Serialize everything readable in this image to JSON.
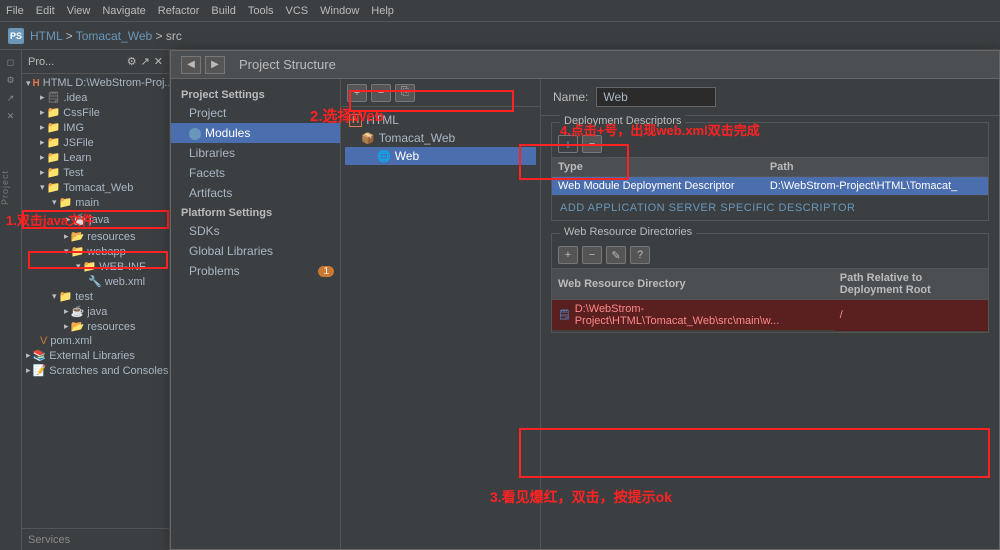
{
  "menubar": {
    "items": [
      "File",
      "Edit",
      "View",
      "Navigate",
      "Refactor",
      "Build",
      "Tools",
      "VCS",
      "Window",
      "Help"
    ]
  },
  "titlebar": {
    "title": "Project Structure",
    "icon_text": "PS"
  },
  "breadcrumb": {
    "parts": [
      "HTML",
      "Tomacat_Web",
      "src"
    ]
  },
  "left_panel": {
    "header": "Project",
    "tree": [
      {
        "label": "Pro...",
        "indent": 0,
        "icon": "📁"
      },
      {
        "label": "HTML D:\\WebStrom-Proj...",
        "indent": 0,
        "icon": "🗂",
        "selected": false
      },
      {
        "label": "idea",
        "indent": 1,
        "icon": "📁"
      },
      {
        "label": "CssFile",
        "indent": 1,
        "icon": "📁"
      },
      {
        "label": "IMG",
        "indent": 1,
        "icon": "📁"
      },
      {
        "label": "JSFile",
        "indent": 1,
        "icon": "📁"
      },
      {
        "label": "Learn",
        "indent": 1,
        "icon": "📁"
      },
      {
        "label": "Test",
        "indent": 1,
        "icon": "📁"
      },
      {
        "label": "Tomacat_Web",
        "indent": 1,
        "icon": "📁"
      },
      {
        "label": "main",
        "indent": 2,
        "icon": "📁"
      },
      {
        "label": "java",
        "indent": 3,
        "icon": "📁",
        "selected": true
      },
      {
        "label": "resources",
        "indent": 3,
        "icon": "📁"
      },
      {
        "label": "webapp",
        "indent": 3,
        "icon": "📁"
      },
      {
        "label": "WEB-INF",
        "indent": 4,
        "icon": "📁"
      },
      {
        "label": "web.xml",
        "indent": 5,
        "icon": "🔧"
      },
      {
        "label": "test",
        "indent": 2,
        "icon": "📁"
      },
      {
        "label": "java",
        "indent": 3,
        "icon": "📁"
      },
      {
        "label": "resources",
        "indent": 3,
        "icon": "📁"
      },
      {
        "label": "pom.xml",
        "indent": 1,
        "icon": "🔧"
      },
      {
        "label": "External Libraries",
        "indent": 0,
        "icon": "📚"
      },
      {
        "label": "Scratches and Consoles",
        "indent": 0,
        "icon": "📝"
      }
    ]
  },
  "dialog": {
    "title": "Project Structure",
    "nav": {
      "back_label": "◀",
      "forward_label": "▶"
    },
    "settings_tree": {
      "project_settings_title": "Project Settings",
      "project_settings_items": [
        "Project",
        "Modules",
        "Libraries",
        "Facets",
        "Artifacts"
      ],
      "platform_settings_title": "Platform Settings",
      "platform_settings_items": [
        "SDKs",
        "Global Libraries",
        "Problems"
      ],
      "selected_item": "Modules",
      "problems_badge": "1"
    },
    "module_pane": {
      "toolbar_buttons": [
        "+",
        "−",
        "⎘"
      ],
      "tree": [
        {
          "label": "HTML",
          "indent": 0,
          "icon": "H"
        },
        {
          "label": "Tomacat_Web",
          "indent": 1,
          "icon": "M"
        },
        {
          "label": "Web",
          "indent": 2,
          "icon": "🌐",
          "selected": true
        }
      ]
    },
    "details": {
      "name_label": "Name:",
      "name_value": "Web",
      "deployment_section_title": "Deployment Descriptors",
      "deployment_toolbar": [
        "+",
        "−"
      ],
      "deployment_columns": [
        "Type",
        "Path"
      ],
      "deployment_rows": [
        {
          "type": "Web Module Deployment Descriptor",
          "path": "D:\\WebStrom-Project\\HTML\\Tomacat_",
          "selected": true
        }
      ],
      "add_descriptor_label": "ADD APPLICATION SERVER SPECIFIC DESCRIPTOR",
      "web_resource_section_title": "Web Resource Directories",
      "web_resource_toolbar": [
        "+",
        "−",
        "✎",
        "?"
      ],
      "web_resource_columns": [
        "Web Resource Directory",
        "Path Relative to Deployment Root"
      ],
      "web_resource_rows": [
        {
          "dir": "D:\\WebStrom-Project\\HTML\\Tomacat_Web\\src\\main\\w...",
          "rel": "/",
          "error": true
        }
      ]
    }
  },
  "annotations": {
    "step1": "1.双击java文件",
    "step2": "2.选择Web",
    "step3": "3.看见爆红，双击，按提示ok",
    "step4": "4.点击+号，出现web.xml双击完成"
  },
  "services_label": "Services"
}
